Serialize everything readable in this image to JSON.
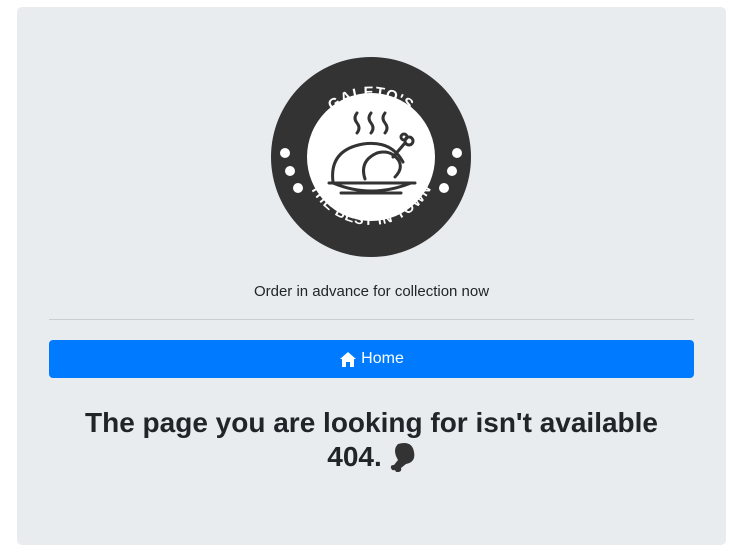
{
  "logo": {
    "top_text": "GALETO'S",
    "bottom_text": "THE BEST IN TOWN",
    "icon": "roast-chicken-icon"
  },
  "tagline": "Order in advance for collection now",
  "nav": {
    "home_label": "Home",
    "home_icon": "home-icon"
  },
  "error": {
    "message": "The page you are looking for isn't available",
    "code": "404.",
    "icon": "drumstick-icon"
  },
  "colors": {
    "card_background": "#e9ecef",
    "button_primary": "#007bff",
    "logo_dark": "#333333"
  }
}
